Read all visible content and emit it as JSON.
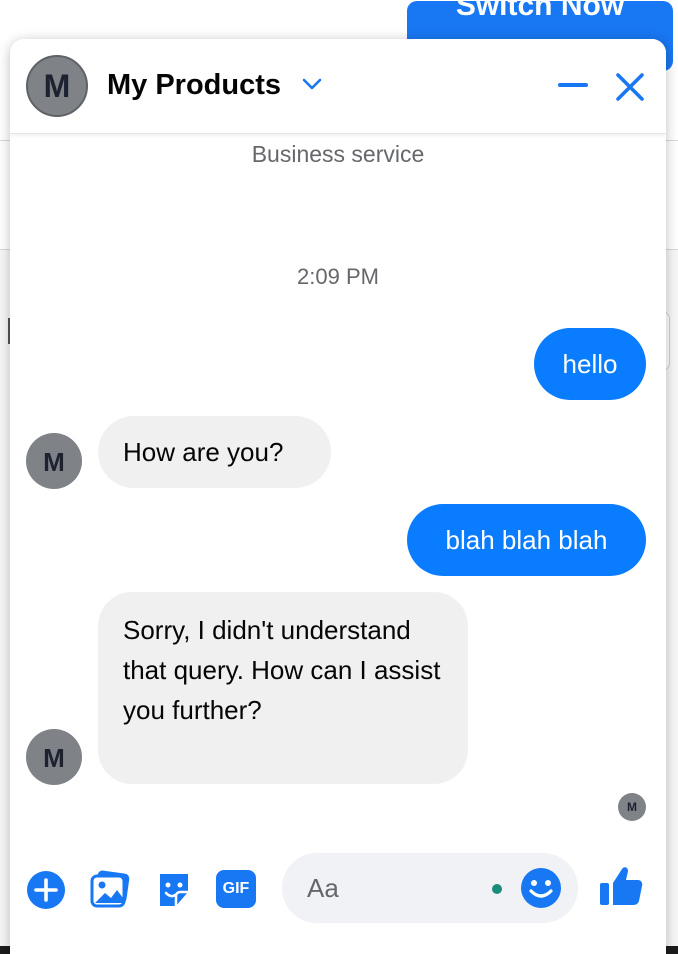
{
  "background": {
    "switch_button_label": "Switch Now"
  },
  "chat": {
    "title": "My Products",
    "avatar_initial": "M",
    "subtitle": "Business service",
    "timestamp": "2:09 PM",
    "messages": [
      {
        "direction": "outgoing",
        "text": "hello"
      },
      {
        "direction": "incoming",
        "text": "How are you?"
      },
      {
        "direction": "outgoing",
        "text": "blah blah blah"
      },
      {
        "direction": "incoming",
        "text": "Sorry, I didn't understand that query. How can I assist you further?"
      }
    ],
    "seen_avatar_initial": "M"
  },
  "composer": {
    "placeholder": "Aa",
    "icons": [
      "plus-icon",
      "photo-icon",
      "sticker-icon",
      "gif-icon",
      "emoji-icon",
      "thumbs-up-icon"
    ],
    "gif_label": "GIF"
  },
  "colors": {
    "accent": "#1877f2",
    "outgoing_bubble": "#0a7cff",
    "incoming_bubble": "#f0f0f0",
    "avatar_bg": "#7f8287"
  }
}
